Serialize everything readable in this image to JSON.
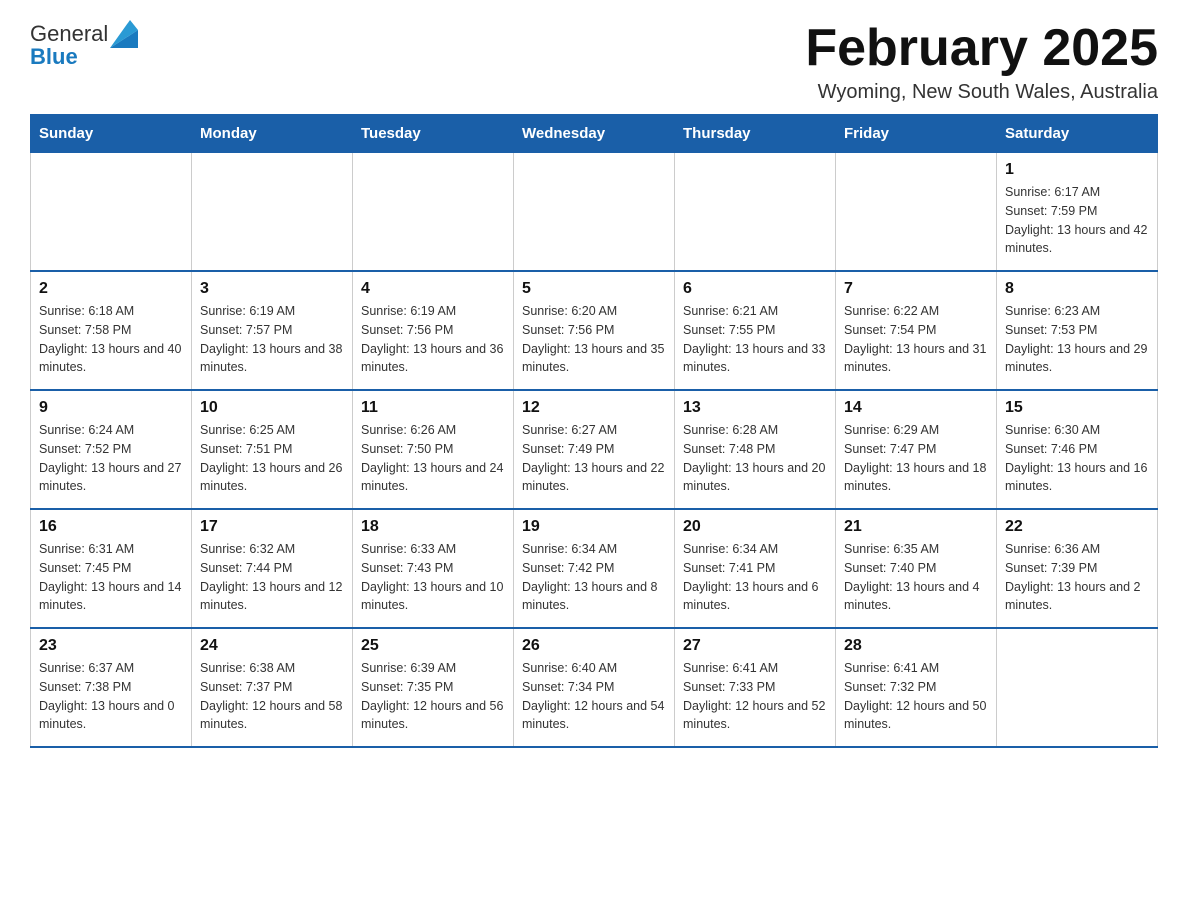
{
  "header": {
    "logo_text_general": "General",
    "logo_text_blue": "Blue",
    "month_title": "February 2025",
    "location": "Wyoming, New South Wales, Australia"
  },
  "days_of_week": [
    "Sunday",
    "Monday",
    "Tuesday",
    "Wednesday",
    "Thursday",
    "Friday",
    "Saturday"
  ],
  "weeks": [
    [
      {
        "day": "",
        "info": ""
      },
      {
        "day": "",
        "info": ""
      },
      {
        "day": "",
        "info": ""
      },
      {
        "day": "",
        "info": ""
      },
      {
        "day": "",
        "info": ""
      },
      {
        "day": "",
        "info": ""
      },
      {
        "day": "1",
        "info": "Sunrise: 6:17 AM\nSunset: 7:59 PM\nDaylight: 13 hours and 42 minutes."
      }
    ],
    [
      {
        "day": "2",
        "info": "Sunrise: 6:18 AM\nSunset: 7:58 PM\nDaylight: 13 hours and 40 minutes."
      },
      {
        "day": "3",
        "info": "Sunrise: 6:19 AM\nSunset: 7:57 PM\nDaylight: 13 hours and 38 minutes."
      },
      {
        "day": "4",
        "info": "Sunrise: 6:19 AM\nSunset: 7:56 PM\nDaylight: 13 hours and 36 minutes."
      },
      {
        "day": "5",
        "info": "Sunrise: 6:20 AM\nSunset: 7:56 PM\nDaylight: 13 hours and 35 minutes."
      },
      {
        "day": "6",
        "info": "Sunrise: 6:21 AM\nSunset: 7:55 PM\nDaylight: 13 hours and 33 minutes."
      },
      {
        "day": "7",
        "info": "Sunrise: 6:22 AM\nSunset: 7:54 PM\nDaylight: 13 hours and 31 minutes."
      },
      {
        "day": "8",
        "info": "Sunrise: 6:23 AM\nSunset: 7:53 PM\nDaylight: 13 hours and 29 minutes."
      }
    ],
    [
      {
        "day": "9",
        "info": "Sunrise: 6:24 AM\nSunset: 7:52 PM\nDaylight: 13 hours and 27 minutes."
      },
      {
        "day": "10",
        "info": "Sunrise: 6:25 AM\nSunset: 7:51 PM\nDaylight: 13 hours and 26 minutes."
      },
      {
        "day": "11",
        "info": "Sunrise: 6:26 AM\nSunset: 7:50 PM\nDaylight: 13 hours and 24 minutes."
      },
      {
        "day": "12",
        "info": "Sunrise: 6:27 AM\nSunset: 7:49 PM\nDaylight: 13 hours and 22 minutes."
      },
      {
        "day": "13",
        "info": "Sunrise: 6:28 AM\nSunset: 7:48 PM\nDaylight: 13 hours and 20 minutes."
      },
      {
        "day": "14",
        "info": "Sunrise: 6:29 AM\nSunset: 7:47 PM\nDaylight: 13 hours and 18 minutes."
      },
      {
        "day": "15",
        "info": "Sunrise: 6:30 AM\nSunset: 7:46 PM\nDaylight: 13 hours and 16 minutes."
      }
    ],
    [
      {
        "day": "16",
        "info": "Sunrise: 6:31 AM\nSunset: 7:45 PM\nDaylight: 13 hours and 14 minutes."
      },
      {
        "day": "17",
        "info": "Sunrise: 6:32 AM\nSunset: 7:44 PM\nDaylight: 13 hours and 12 minutes."
      },
      {
        "day": "18",
        "info": "Sunrise: 6:33 AM\nSunset: 7:43 PM\nDaylight: 13 hours and 10 minutes."
      },
      {
        "day": "19",
        "info": "Sunrise: 6:34 AM\nSunset: 7:42 PM\nDaylight: 13 hours and 8 minutes."
      },
      {
        "day": "20",
        "info": "Sunrise: 6:34 AM\nSunset: 7:41 PM\nDaylight: 13 hours and 6 minutes."
      },
      {
        "day": "21",
        "info": "Sunrise: 6:35 AM\nSunset: 7:40 PM\nDaylight: 13 hours and 4 minutes."
      },
      {
        "day": "22",
        "info": "Sunrise: 6:36 AM\nSunset: 7:39 PM\nDaylight: 13 hours and 2 minutes."
      }
    ],
    [
      {
        "day": "23",
        "info": "Sunrise: 6:37 AM\nSunset: 7:38 PM\nDaylight: 13 hours and 0 minutes."
      },
      {
        "day": "24",
        "info": "Sunrise: 6:38 AM\nSunset: 7:37 PM\nDaylight: 12 hours and 58 minutes."
      },
      {
        "day": "25",
        "info": "Sunrise: 6:39 AM\nSunset: 7:35 PM\nDaylight: 12 hours and 56 minutes."
      },
      {
        "day": "26",
        "info": "Sunrise: 6:40 AM\nSunset: 7:34 PM\nDaylight: 12 hours and 54 minutes."
      },
      {
        "day": "27",
        "info": "Sunrise: 6:41 AM\nSunset: 7:33 PM\nDaylight: 12 hours and 52 minutes."
      },
      {
        "day": "28",
        "info": "Sunrise: 6:41 AM\nSunset: 7:32 PM\nDaylight: 12 hours and 50 minutes."
      },
      {
        "day": "",
        "info": ""
      }
    ]
  ]
}
